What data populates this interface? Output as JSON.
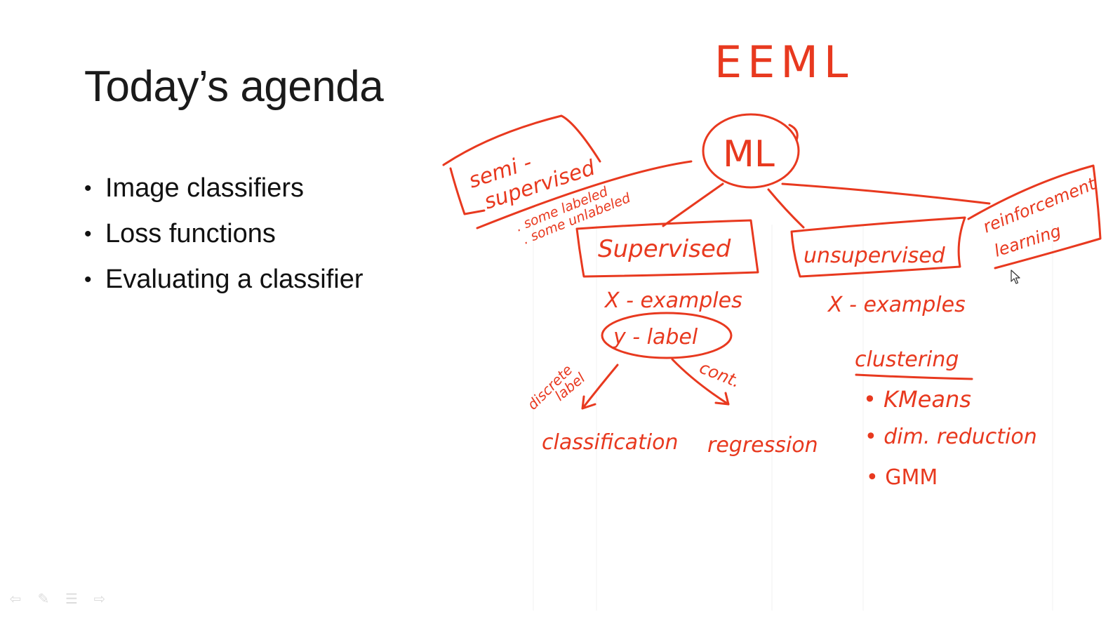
{
  "slide": {
    "title": "Today’s agenda",
    "bullets": [
      "Image classifiers",
      "Loss functions",
      "Evaluating a classifier"
    ]
  },
  "annotations": {
    "color": "#e8391f",
    "top_label": "EEML",
    "root": "ML",
    "semi": [
      "semi -",
      "supervised"
    ],
    "semi_notes": [
      ". some labeled",
      ". some unlabeled"
    ],
    "supervised": "Supervised",
    "unsupervised": "unsupervised",
    "reinforcement": [
      "reinforcement",
      "learning"
    ],
    "sup_x": "X - examples",
    "sup_y": "y - label",
    "discrete": [
      "discrete",
      "label"
    ],
    "cont": "cont.",
    "classification": "classification",
    "regression": "regression",
    "unsup_x": "X - examples",
    "clustering": "clustering",
    "clustering_items": [
      "• KMeans",
      "• dim. reduction",
      "• GMM"
    ]
  },
  "nav": {
    "prev_icon": "arrow-left-icon",
    "pen_icon": "pen-icon",
    "menu_icon": "menu-icon",
    "next_icon": "arrow-right-icon"
  }
}
